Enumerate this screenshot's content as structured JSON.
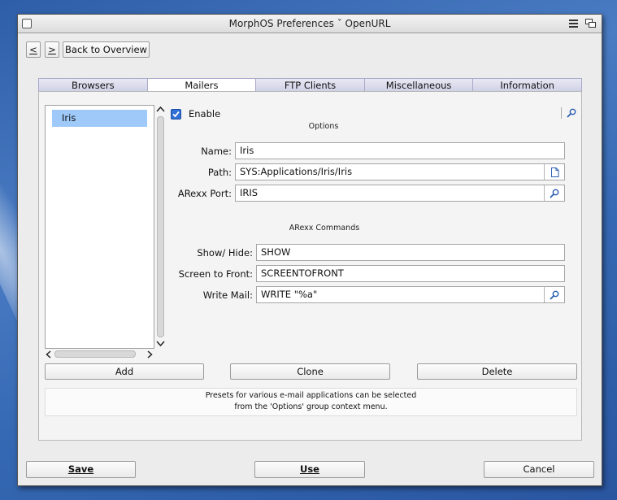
{
  "window": {
    "title": "MorphOS Preferences ˇ OpenURL"
  },
  "nav": {
    "prev": "<",
    "next": ">",
    "back_label": "Back to Overview"
  },
  "tabs": [
    {
      "label": "Browsers"
    },
    {
      "label": "Mailers"
    },
    {
      "label": "FTP Clients"
    },
    {
      "label": "Miscellaneous"
    },
    {
      "label": "Information"
    }
  ],
  "active_tab": "Mailers",
  "list": {
    "items": [
      "Iris"
    ],
    "selected": "Iris"
  },
  "enable": {
    "label": "Enable",
    "checked": true
  },
  "options_section": {
    "title": "Options"
  },
  "fields": {
    "name": {
      "label": "Name:",
      "value": "Iris"
    },
    "path": {
      "label": "Path:",
      "value": "SYS:Applications/Iris/Iris"
    },
    "arexx_port": {
      "label": "ARexx Port:",
      "value": "IRIS"
    }
  },
  "arexx_section": {
    "title": "ARexx Commands"
  },
  "commands": {
    "show_hide": {
      "label": "Show/ Hide:",
      "value": "SHOW"
    },
    "screen_to_front": {
      "label": "Screen to Front:",
      "value": "SCREENTOFRONT"
    },
    "write_mail": {
      "label": "Write Mail:",
      "value": "WRITE \"%a\""
    }
  },
  "list_buttons": {
    "add": "Add",
    "clone": "Clone",
    "delete": "Delete"
  },
  "note": {
    "line1": "Presets for various e-mail applications can be selected",
    "line2": "from the 'Options' group context menu."
  },
  "footer": {
    "save": "Save",
    "use": "Use",
    "cancel": "Cancel"
  },
  "colors": {
    "selection": "#9ec9f8",
    "checkbox": "#2f6fd6",
    "desktop": "#3569b3"
  }
}
